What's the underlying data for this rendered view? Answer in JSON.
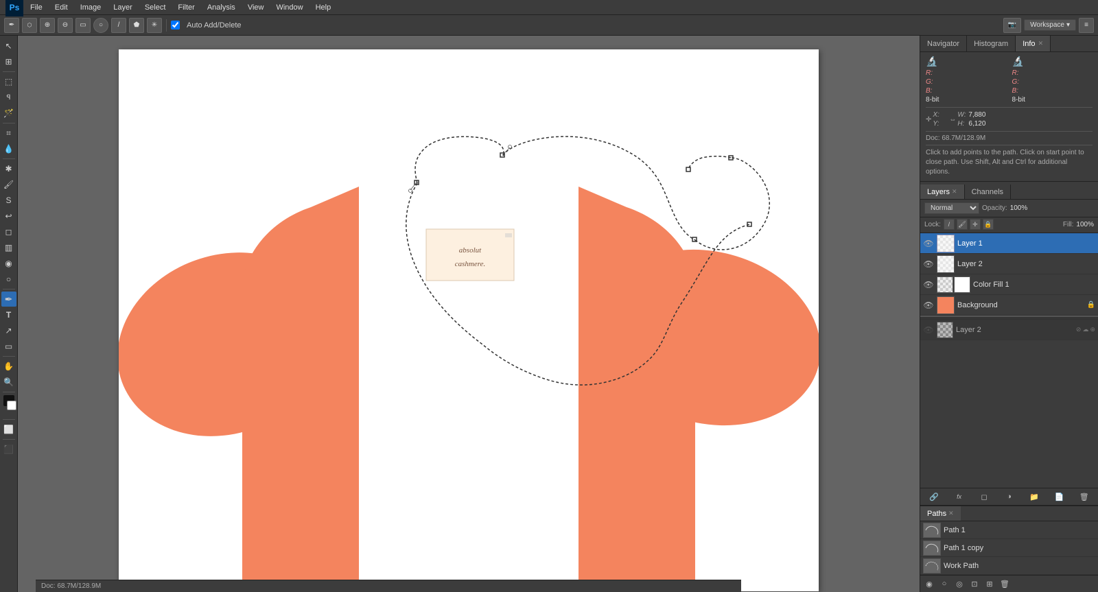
{
  "app": {
    "title": "Photoshop",
    "logo": "Ps"
  },
  "menu": {
    "items": [
      "File",
      "Edit",
      "Image",
      "Layer",
      "Select",
      "Filter",
      "Analysis",
      "View",
      "Window",
      "Help"
    ]
  },
  "options_bar": {
    "tool_label": "Auto Add/Delete",
    "workspace_label": "Workspace",
    "workspace_arrow": "▾"
  },
  "panel_tabs_top": {
    "tabs": [
      {
        "label": "Navigator",
        "active": false
      },
      {
        "label": "Histogram",
        "active": false
      },
      {
        "label": "Info",
        "active": true,
        "closable": true
      }
    ]
  },
  "info_panel": {
    "r_label": "R:",
    "r_value": "",
    "g_label": "G:",
    "g_value": "",
    "b_label": "B:",
    "b_value": "",
    "bit_depth": "8-bit",
    "x_label": "X:",
    "x_value": "",
    "y_label": "Y:",
    "y_value": "",
    "w_label": "W:",
    "w_value": "7,880",
    "h_label": "H:",
    "h_value": "6,120",
    "second_r": "R:",
    "second_g": "G:",
    "second_b": "B:",
    "second_bit": "8-bit",
    "second_x": "X:",
    "second_y": "Y:",
    "doc_info": "Doc: 68.7M/128.9M",
    "hint": "Click to add points to the path.  Click on start point to close path.  Use Shift, Alt and Ctrl for additional options."
  },
  "layers_panel": {
    "tabs": [
      {
        "label": "Layers",
        "active": true,
        "closable": true
      },
      {
        "label": "Channels",
        "active": false
      }
    ],
    "blend_mode": "Normal",
    "opacity_label": "Opacity:",
    "opacity_value": "100%",
    "lock_label": "Lock:",
    "fill_label": "Fill:",
    "fill_value": "100%",
    "layers": [
      {
        "name": "Layer 1",
        "active": true,
        "visible": true,
        "type": "normal",
        "thumb_color": "white"
      },
      {
        "name": "Layer 2",
        "active": false,
        "visible": true,
        "type": "normal",
        "thumb_color": "white"
      },
      {
        "name": "Color Fill 1",
        "active": false,
        "visible": true,
        "type": "fill",
        "thumb_color": "white"
      },
      {
        "name": "Background",
        "active": false,
        "visible": true,
        "type": "background",
        "thumb_color": "orange",
        "locked": true
      }
    ],
    "hidden_layers": [
      {
        "name": "Layer 2",
        "active": false,
        "visible": false
      }
    ]
  },
  "paths_panel": {
    "tabs": [
      {
        "label": "Paths",
        "active": true,
        "closable": true
      }
    ],
    "paths": [
      {
        "name": "Path 1"
      },
      {
        "name": "Path 1 copy"
      },
      {
        "name": "Work Path"
      }
    ]
  },
  "canvas": {
    "label_line1": "absolut",
    "label_line2": "cashmere."
  },
  "bottom_icons": {
    "icons": [
      "🔗",
      "fx",
      "◻",
      "◉",
      "📁",
      "🗑"
    ]
  }
}
